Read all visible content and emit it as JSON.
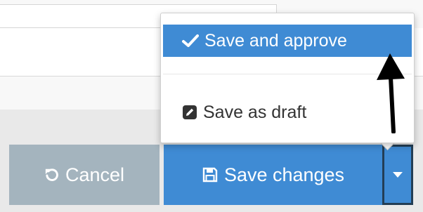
{
  "dropdown": {
    "items": [
      {
        "label": "Save and approve",
        "icon": "checkmark-icon",
        "active": true
      },
      {
        "label": "Save as draft",
        "icon": "pencil-square-icon",
        "active": false
      }
    ]
  },
  "actions": {
    "cancel_label": "Cancel",
    "cancel_icon": "undo-icon",
    "save_label": "Save changes",
    "save_icon": "floppy-disk-icon",
    "caret_icon": "caret-down-icon"
  },
  "colors": {
    "primary": "#3f8bd4",
    "cancel": "#a4b4be",
    "caret_border": "#233e55",
    "arrow": "#000000"
  }
}
